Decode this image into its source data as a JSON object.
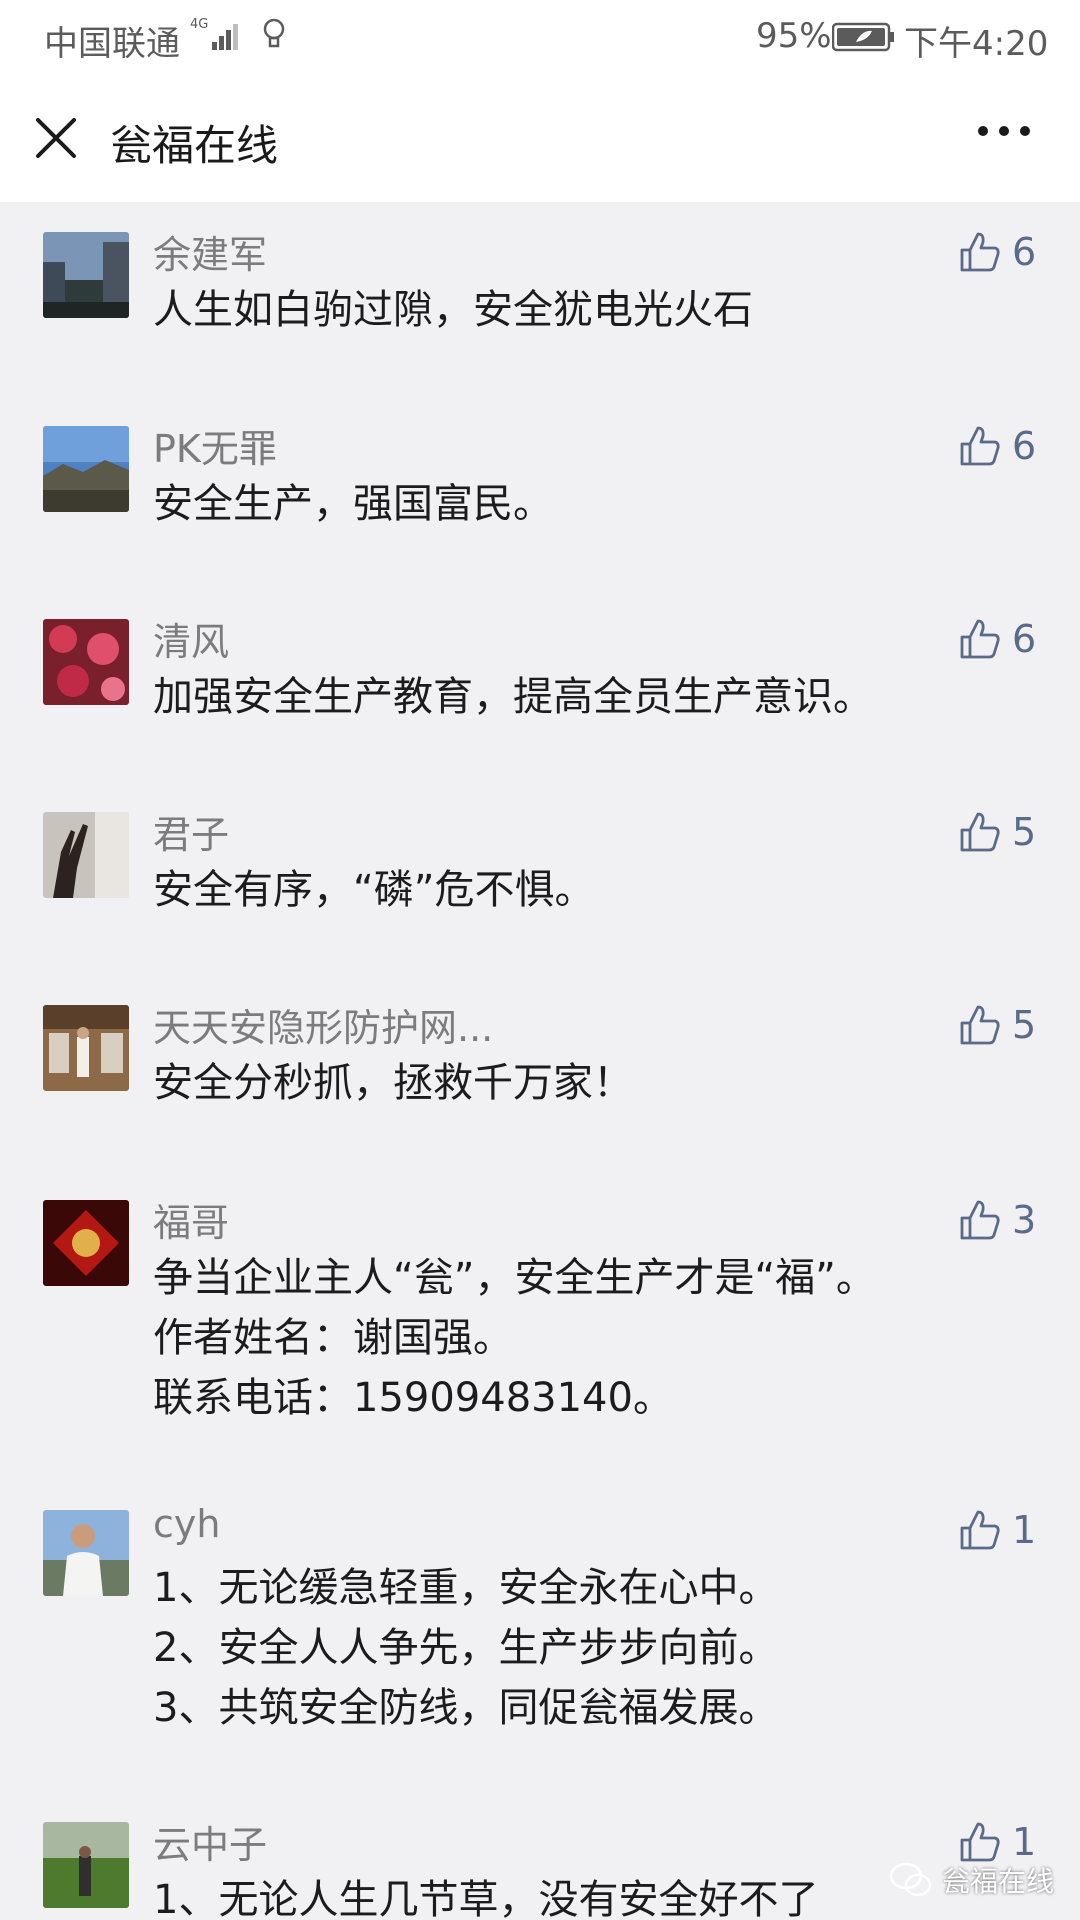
{
  "status": {
    "carrier": "中国联通",
    "network": "4G",
    "battery": "95%",
    "time": "下午4:20"
  },
  "nav": {
    "title": "瓮福在线",
    "close_icon": "close-icon",
    "more_icon": "more-icon"
  },
  "comments": [
    {
      "nick": "余建军",
      "likes": "6",
      "lines": [
        "人生如白驹过隙，安全犹电光火石"
      ]
    },
    {
      "nick": "PK无罪",
      "likes": "6",
      "lines": [
        "安全生产，强国富民。"
      ]
    },
    {
      "nick": "清风",
      "likes": "6",
      "lines": [
        "加强安全生产教育，提高全员生产意识。"
      ]
    },
    {
      "nick": "君子",
      "likes": "5",
      "lines": [
        "安全有序，“磷”危不惧。"
      ]
    },
    {
      "nick": "天天安隐形防护网...",
      "likes": "5",
      "lines": [
        "安全分秒抓，拯救千万家！"
      ]
    },
    {
      "nick": "福哥",
      "likes": "3",
      "lines": [
        "争当企业主人“瓮”，安全生产才是“福”。",
        "作者姓名：谢国强。",
        "联系电话：15909483140。"
      ]
    },
    {
      "nick": "cyh",
      "likes": "1",
      "lines": [
        "1、无论缓急轻重，安全永在心中。",
        "2、安全人人争先，生产步步向前。",
        "3、共筑安全防线，同促瓮福发展。"
      ]
    },
    {
      "nick": "云中子",
      "likes": "1",
      "lines": [
        "1、无论人生几节草，没有安全好不了"
      ]
    }
  ],
  "watermark": "瓮福在线",
  "colors": {
    "background": "#f1f1f3",
    "like_blue": "#5a6a8a",
    "nick_gray": "#7c7c7c"
  }
}
